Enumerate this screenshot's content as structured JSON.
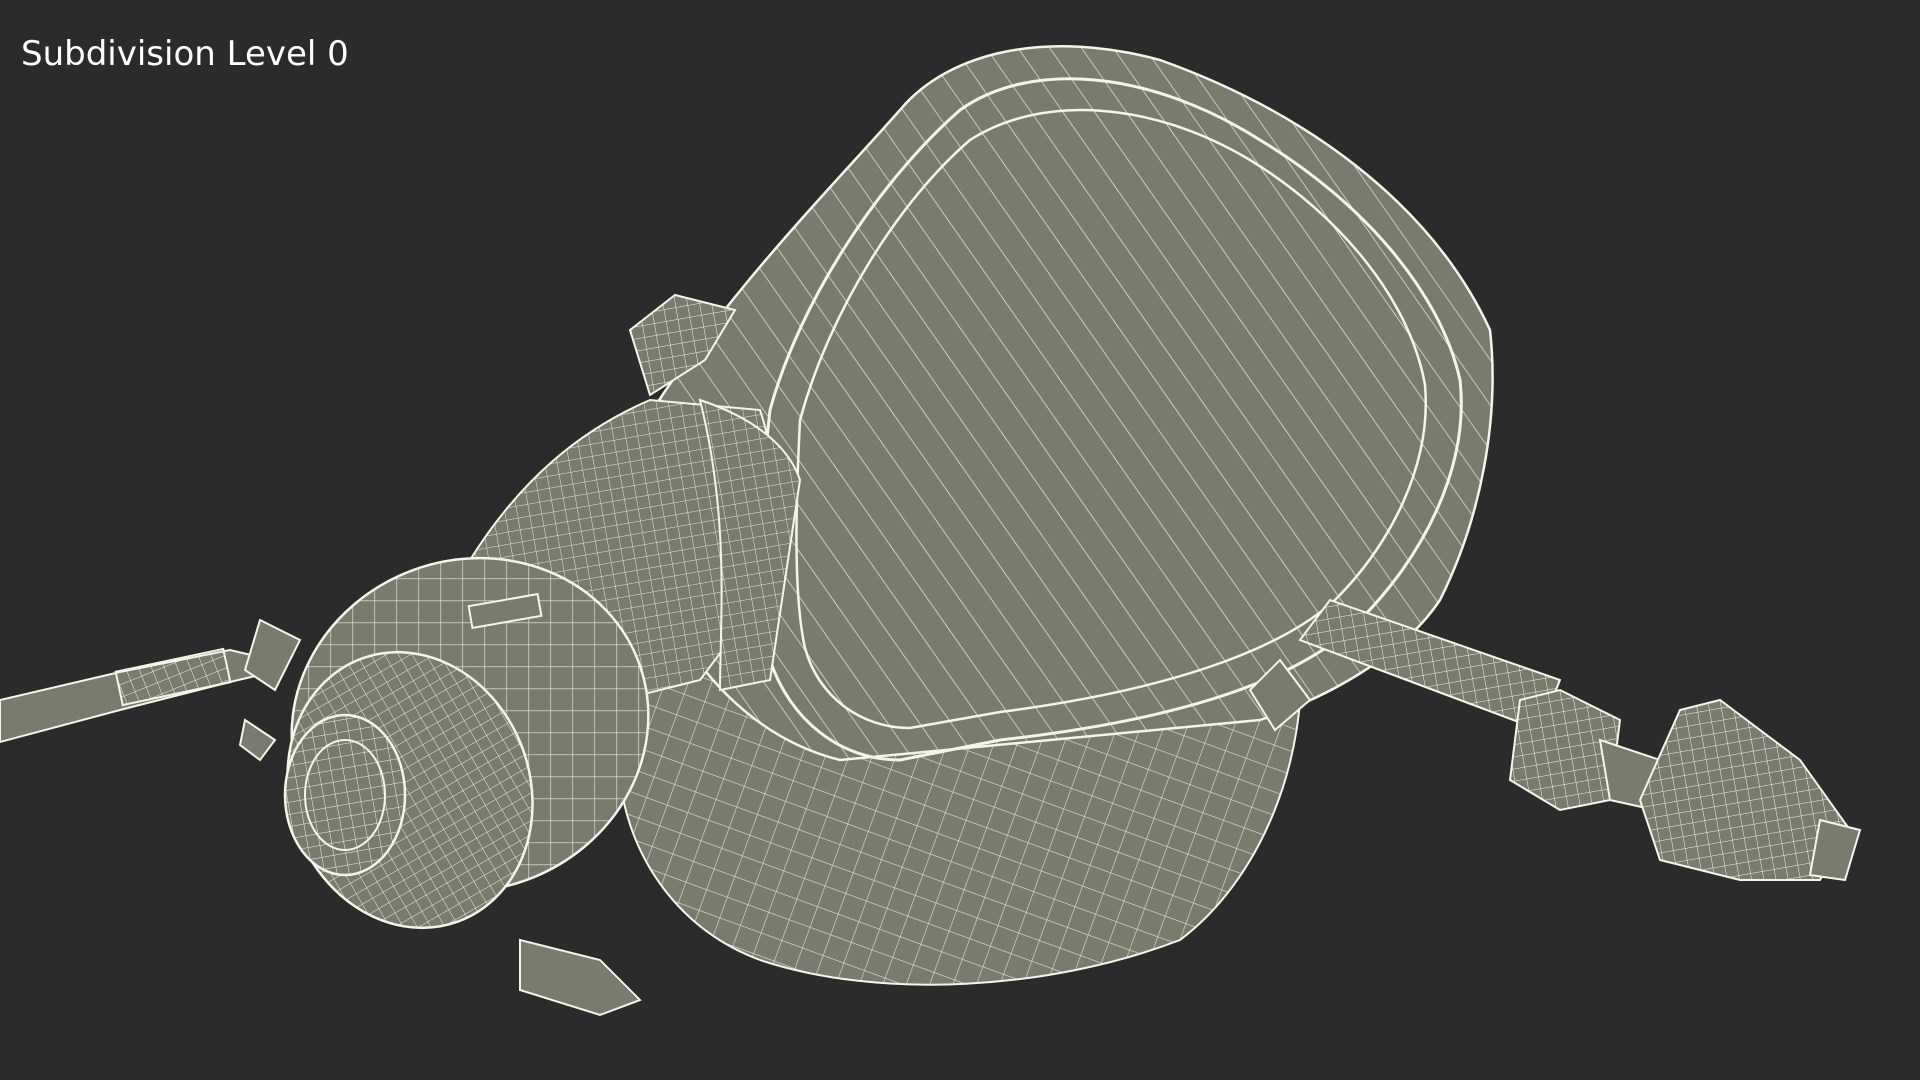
{
  "viewport": {
    "label": "Subdivision Level 0",
    "background_color": "#2b2b2b",
    "mesh_fill_color": "#7a7a6e",
    "mesh_wire_color": "#f4f4e8"
  }
}
